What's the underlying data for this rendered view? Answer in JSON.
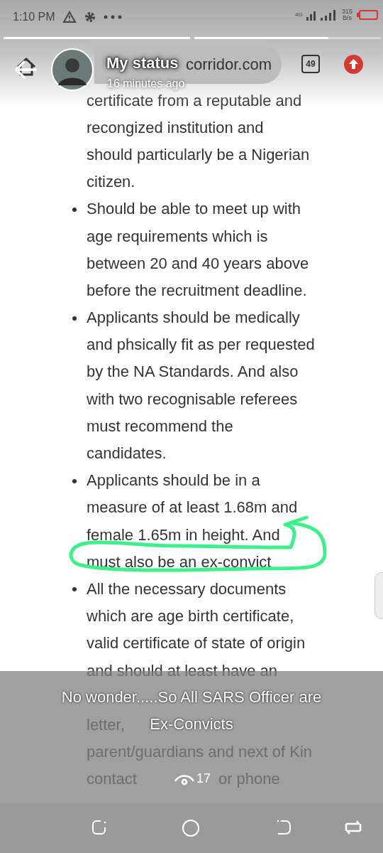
{
  "status_bar": {
    "time": "1:10 PM",
    "network": "4G",
    "speed_value": "315",
    "speed_unit": "B/s"
  },
  "progress": [
    {
      "level": 1
    },
    {
      "level": 0.72
    }
  ],
  "header": {
    "title": "My status",
    "subtitle": "16 minutes ago"
  },
  "browser": {
    "url": "corridor.com",
    "tab_count": "49"
  },
  "list": [
    {
      "bullet": false,
      "lines": [
        [
          "certificate from a reputable and"
        ],
        [
          "recongized institution and"
        ],
        [
          "should particularly be a Nigerian"
        ],
        [
          "citizen."
        ]
      ]
    },
    {
      "bullet": true,
      "lines": [
        [
          "Should be able to meet up with"
        ],
        [
          "age requirements which is"
        ],
        [
          "between 20 and 40 years above"
        ],
        [
          "before the recruitment deadline."
        ]
      ]
    },
    {
      "bullet": true,
      "lines": [
        [
          "Applicants should be medically"
        ],
        [
          "and phsically fit as per requested"
        ],
        [
          "by the NA Standards. And also"
        ],
        [
          "with two recognisable referees"
        ],
        [
          "must recommend the"
        ],
        [
          "candidates."
        ]
      ]
    },
    {
      "bullet": true,
      "lines": [
        [
          "Applicants should be in a"
        ],
        [
          "measure of at least 1.68m and"
        ],
        [
          "female 1.65m in height. And"
        ],
        [
          "must also be an ex-convict"
        ]
      ]
    },
    {
      "bullet": true,
      "lines": [
        [
          "All the necessary documents"
        ],
        [
          "which are age birth certificate,"
        ],
        [
          "valid certificate of state of origin"
        ],
        [
          "and should at least have an"
        ],
        [
          "letter,"
        ],
        [
          "parent/guardians and next of Kin"
        ],
        [
          "contact",
          "or phone"
        ]
      ]
    }
  ],
  "caption": [
    "No wonder.....So All SARS Officer are",
    "Ex-Convicts"
  ],
  "views": "17"
}
